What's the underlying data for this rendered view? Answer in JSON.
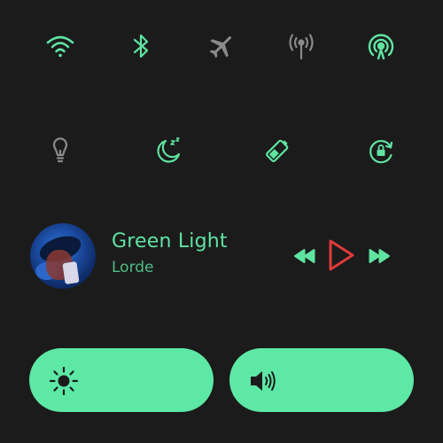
{
  "theme": {
    "accent": "#5fe3a1",
    "icon_inactive": "#8a8a8a",
    "play_color": "#e03a3a",
    "pill_color": "#5de8a6",
    "background": "#1b1b1b"
  },
  "quick_settings": [
    {
      "icon": "wifi-icon",
      "state": "on"
    },
    {
      "icon": "bluetooth-icon",
      "state": "on"
    },
    {
      "icon": "airplane-icon",
      "state": "off"
    },
    {
      "icon": "hotspot-icon",
      "state": "off"
    },
    {
      "icon": "nfc-broadcast-icon",
      "state": "on"
    },
    {
      "icon": "flashlight-icon",
      "state": "off"
    },
    {
      "icon": "do-not-disturb-icon",
      "state": "on"
    },
    {
      "icon": "battery-saver-icon",
      "state": "on"
    },
    {
      "icon": "rotation-lock-icon",
      "state": "on"
    }
  ],
  "media": {
    "title": "Green Light",
    "artist": "Lorde",
    "controls": [
      "rewind-icon",
      "play-icon",
      "fast-forward-icon"
    ]
  },
  "sliders": [
    {
      "icon": "brightness-icon"
    },
    {
      "icon": "volume-icon"
    }
  ]
}
